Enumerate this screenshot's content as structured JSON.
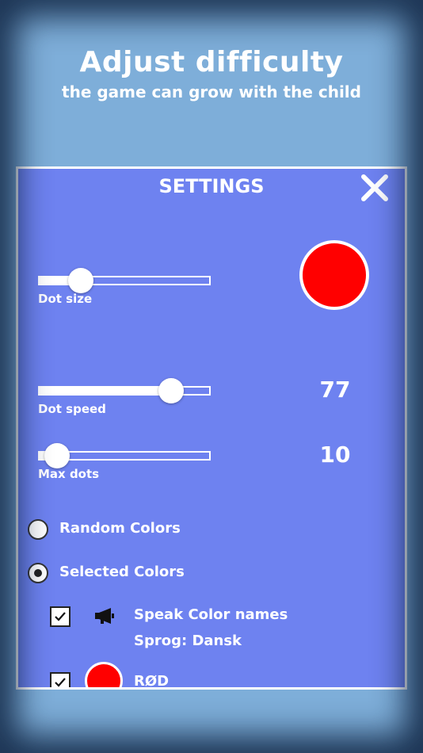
{
  "header": {
    "title": "Adjust difficulty",
    "subtitle": "the game can grow with the child"
  },
  "settings": {
    "title": "SETTINGS",
    "close_icon": "close-icon",
    "dot_size": {
      "label": "Dot size",
      "level": 0.24,
      "preview_color": "#ff0000"
    },
    "dot_speed": {
      "label": "Dot speed",
      "value": "77",
      "level": 0.77
    },
    "max_dots": {
      "label": "Max dots",
      "value": "10",
      "level": 0.1
    },
    "color_mode": {
      "options": [
        {
          "label": "Random Colors",
          "selected": false
        },
        {
          "label": "Selected Colors",
          "selected": true
        }
      ]
    },
    "speak": {
      "checked": true,
      "icon": "megaphone-icon",
      "label": "Speak Color names",
      "language": "Sprog: Dansk"
    },
    "colors": [
      {
        "name": "RØD",
        "checked": true,
        "color": "#ff0000"
      }
    ]
  }
}
